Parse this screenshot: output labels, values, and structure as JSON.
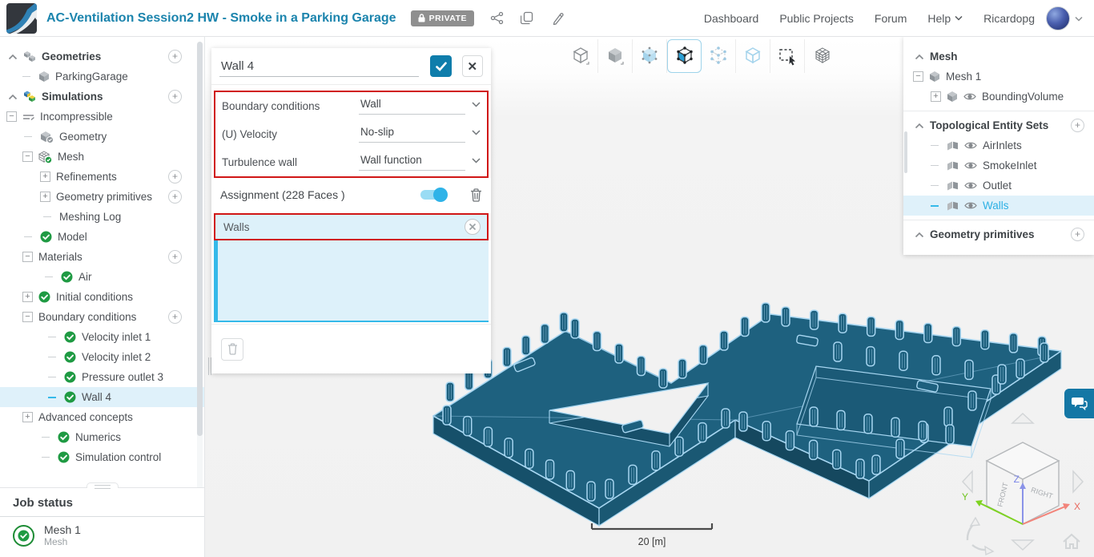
{
  "header": {
    "title": "AC-Ventilation Session2 HW - Smoke in a Parking Garage",
    "privacy_badge": "PRIVATE",
    "actions": [
      "share",
      "copy",
      "edit"
    ],
    "nav": [
      "Dashboard",
      "Public Projects",
      "Forum",
      "Help"
    ],
    "user": "Ricardopg"
  },
  "sidebar": {
    "tree": [
      {
        "label": "Geometries",
        "bold": 1,
        "caret": 1,
        "icon": "cubes",
        "plus": 1,
        "ind": 10
      },
      {
        "label": "ParkingGarage",
        "icon": "cube",
        "conn": 1,
        "ind": 28
      },
      {
        "label": "Simulations",
        "bold": 1,
        "caret": 1,
        "icon": "sim",
        "plus": 1,
        "ind": 10
      },
      {
        "label": "Incompressible",
        "exp": "minus",
        "icon": "inc",
        "ind": 8
      },
      {
        "label": "Geometry",
        "icon": "geom",
        "conn": 1,
        "ind": 30
      },
      {
        "label": "Mesh",
        "exp": "minus",
        "icon": "mesh",
        "ind": 28
      },
      {
        "label": "Refinements",
        "exp": "plus",
        "plus": 1,
        "ind": 50
      },
      {
        "label": "Geometry primitives",
        "exp": "plus",
        "plus": 1,
        "ind": 50
      },
      {
        "label": "Meshing Log",
        "conn": 1,
        "ind": 54
      },
      {
        "label": "Model",
        "check": 1,
        "conn": 1,
        "ind": 30
      },
      {
        "label": "Materials",
        "exp": "minus",
        "plus": 1,
        "ind": 28
      },
      {
        "label": "Air",
        "check": 1,
        "conn": 1,
        "ind": 56
      },
      {
        "label": "Initial conditions",
        "exp": "plus",
        "check": 1,
        "ind": 28
      },
      {
        "label": "Boundary conditions",
        "exp": "minus",
        "plus": 1,
        "ind": 28
      },
      {
        "label": "Velocity inlet 1",
        "check": 1,
        "conn": 1,
        "ind": 60
      },
      {
        "label": "Velocity inlet 2",
        "check": 1,
        "conn": 1,
        "ind": 60
      },
      {
        "label": "Pressure outlet 3",
        "check": 1,
        "conn": 1,
        "ind": 60
      },
      {
        "label": "Wall 4",
        "check": 1,
        "conn": 1,
        "sel": 1,
        "ind": 60
      },
      {
        "label": "Advanced concepts",
        "exp": "plus",
        "ind": 28
      },
      {
        "label": "Numerics",
        "check": 1,
        "conn": 1,
        "ind": 52
      },
      {
        "label": "Simulation control",
        "check": 1,
        "conn": 1,
        "ind": 52
      }
    ],
    "job_status": {
      "title": "Job status",
      "jobs": [
        {
          "name": "Mesh 1",
          "type": "Mesh",
          "status": "success"
        }
      ]
    }
  },
  "panel": {
    "name_value": "Wall 4",
    "fields": [
      {
        "label": "Boundary conditions",
        "value": "Wall"
      },
      {
        "label": "(U) Velocity",
        "value": "No-slip"
      },
      {
        "label": "Turbulence wall",
        "value": "Wall function"
      }
    ],
    "assignment_label": "Assignment (228 Faces )",
    "chips": [
      "Walls"
    ]
  },
  "viewport_toolbar": {
    "icons": [
      {
        "name": "fit-view-cube-icon",
        "selected": false
      },
      {
        "name": "solid-view-cube-icon",
        "selected": false
      },
      {
        "name": "translucent-view-cube-icon",
        "selected": false
      },
      {
        "name": "surface-select-cube-icon",
        "selected": true
      },
      {
        "name": "vertex-select-cube-icon",
        "selected": false
      },
      {
        "name": "wireframe-view-cube-icon",
        "selected": false
      },
      {
        "name": "box-select-icon",
        "selected": false
      },
      {
        "name": "mesh-display-icon",
        "selected": false
      }
    ]
  },
  "right_panel": {
    "tree": [
      {
        "label": "Mesh",
        "bold": 1,
        "caret": 1,
        "ind": 14
      },
      {
        "label": "Mesh 1",
        "exp": "minus",
        "icon": "cube",
        "ind": 12
      },
      {
        "label": "BoundingVolume",
        "exp": "plus",
        "eye": 1,
        "icon": "cube",
        "ind": 34
      },
      {
        "div": 1
      },
      {
        "label": "Topological Entity Sets",
        "bold": 1,
        "caret": 1,
        "plus": 1,
        "ind": 14
      },
      {
        "label": "AirInlets",
        "eye": 1,
        "icon": "faces",
        "conn": 1,
        "ind": 34
      },
      {
        "label": "SmokeInlet",
        "eye": 1,
        "icon": "faces",
        "conn": 1,
        "ind": 34
      },
      {
        "label": "Outlet",
        "eye": 1,
        "icon": "faces",
        "conn": 1,
        "ind": 34
      },
      {
        "label": "Walls",
        "eye": 1,
        "icon": "faces",
        "conn": 1,
        "sel": 1,
        "blue": 1,
        "ind": 34
      },
      {
        "div": 1
      },
      {
        "label": "Geometry primitives",
        "bold": 1,
        "caret": 1,
        "plus": 1,
        "ind": 14
      }
    ]
  },
  "viewport": {
    "scale_label": "20 [m]",
    "view_cube": {
      "front": "FRONT",
      "right": "RIGHT",
      "axes": {
        "x": "X",
        "y": "Y",
        "z": "Z"
      }
    }
  },
  "colors": {
    "accent_blue": "#2fb3e8",
    "brand_blue": "#1b84ad",
    "success_green": "#1f9a43",
    "alert_red": "#d01616",
    "model_teal": "#1e617f",
    "model_edge": "#a7d6f1"
  }
}
